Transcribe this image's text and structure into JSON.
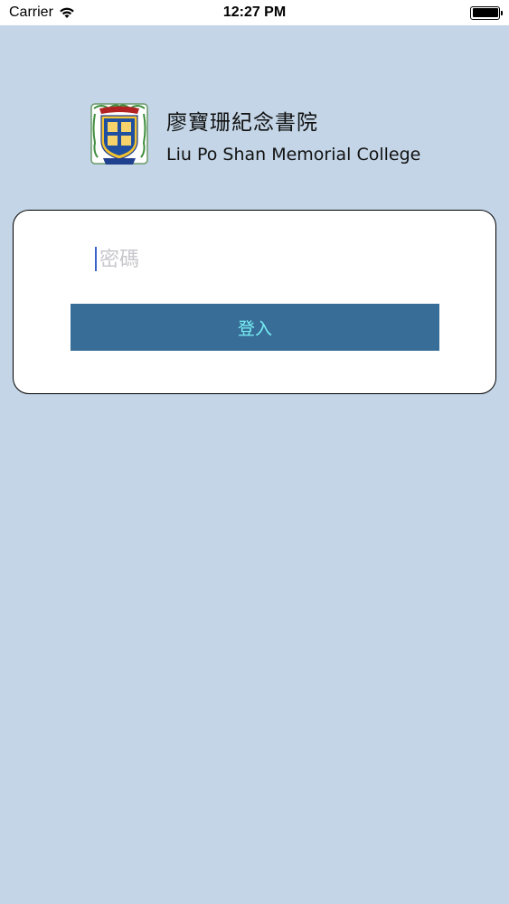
{
  "status_bar": {
    "carrier": "Carrier",
    "time": "12:27 PM",
    "wifi_icon": "wifi-icon",
    "battery_icon": "battery-full-icon"
  },
  "header": {
    "crest_icon": "school-crest-logo",
    "name_zh": "廖寶珊紀念書院",
    "name_en": "Liu Po Shan Memorial College"
  },
  "login": {
    "password_placeholder": "密碼",
    "password_value": "",
    "login_button_label": "登入"
  },
  "colors": {
    "background": "#c3d5e6",
    "button_bg": "#376d97",
    "button_text": "#78f0f4",
    "card_bg": "#ffffff"
  }
}
